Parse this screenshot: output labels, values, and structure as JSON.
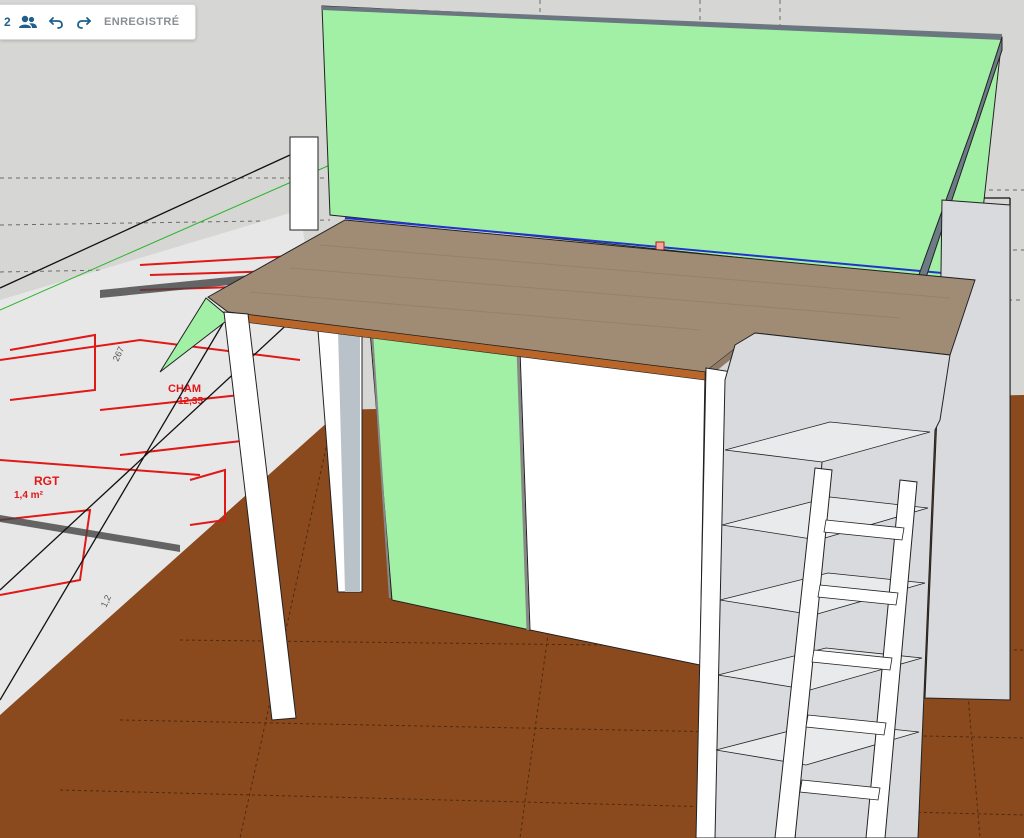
{
  "toolbar": {
    "collaborator_count": "2",
    "collaborators_icon": "users-icon",
    "undo_icon": "undo-icon",
    "redo_icon": "redo-icon",
    "save_status": "ENREGISTRÉ"
  },
  "floor_plan_labels": {
    "room_1_name": "CHAM",
    "room_1_area": "12,35",
    "room_2_name": "RGT",
    "room_2_area": "1,4 m²",
    "dim_1": "267",
    "dim_2": "1,2"
  },
  "colors": {
    "background": "#d6d6d4",
    "floor": "#8a4a1e",
    "green_wall": "#a2f0a6",
    "plank": "#a08b75",
    "plank_edge": "#b8662a",
    "plan_red": "#e01818",
    "accent": "#1e5f8c"
  }
}
